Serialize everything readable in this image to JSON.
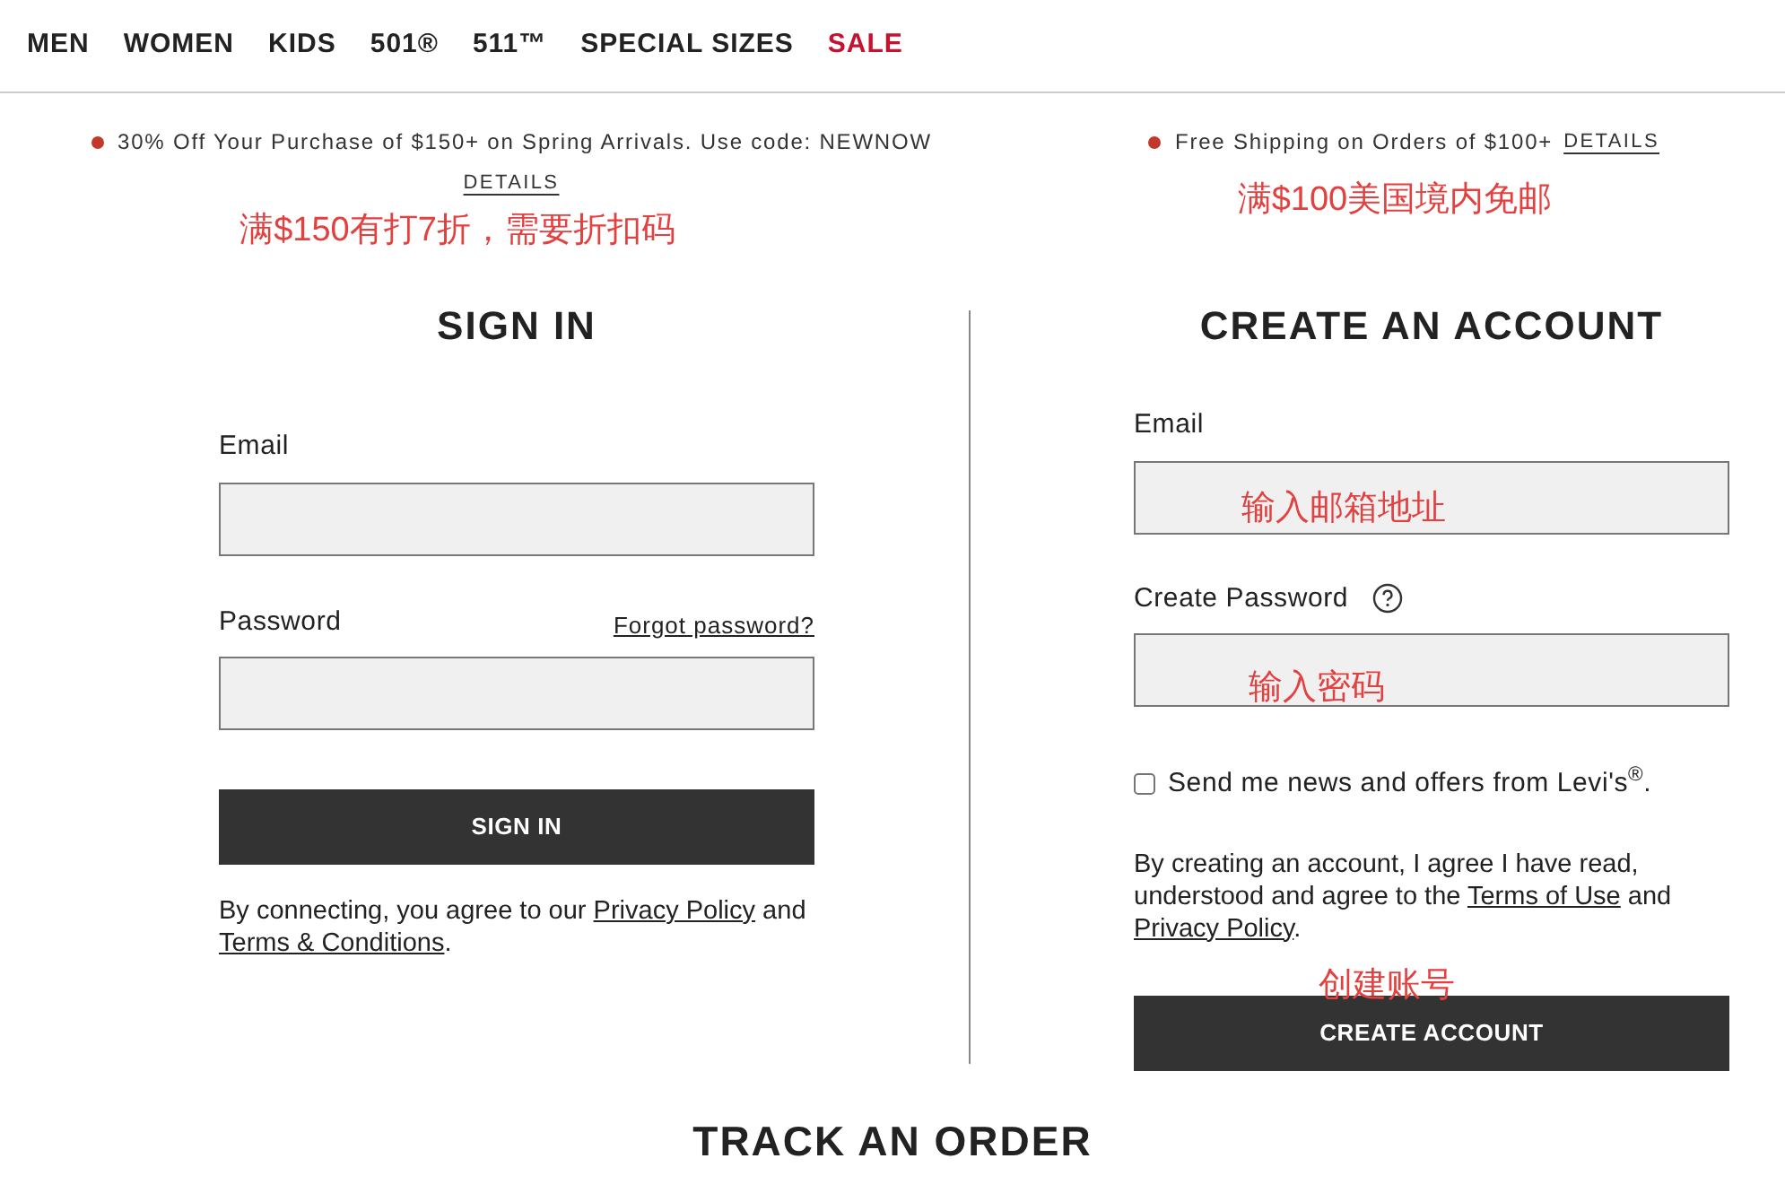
{
  "nav": [
    {
      "label": "MEN",
      "kind": "normal"
    },
    {
      "label": "WOMEN",
      "kind": "normal"
    },
    {
      "label": "KIDS",
      "kind": "normal"
    },
    {
      "label": "501®",
      "kind": "normal"
    },
    {
      "label": "511™",
      "kind": "normal"
    },
    {
      "label": "SPECIAL SIZES",
      "kind": "normal"
    },
    {
      "label": "SALE",
      "kind": "sale"
    }
  ],
  "promos": [
    {
      "text": "30% Off Your Purchase of $150+ on Spring Arrivals. Use code: NEWNOW",
      "link": "DETAILS",
      "annotation": "满$150有打7折，需要折扣码"
    },
    {
      "text": "Free Shipping on Orders of $100+",
      "link": "DETAILS",
      "annotation": "满$100美国境内免邮"
    }
  ],
  "sign_in": {
    "title": "SIGN IN",
    "email_label": "Email",
    "password_label": "Password",
    "forgot": "Forgot password?",
    "button": "SIGN IN",
    "legal": [
      {
        "text": "By connecting, you agree to our ",
        "link": false
      },
      {
        "text": "Privacy Policy",
        "link": true
      },
      {
        "text": " and ",
        "link": false
      },
      {
        "text": "Terms & Conditions",
        "link": true
      },
      {
        "text": ".",
        "link": false
      }
    ]
  },
  "create": {
    "title": "CREATE AN ACCOUNT",
    "email_label": "Email",
    "email_annotation": "输入邮箱地址",
    "password_label": "Create Password",
    "password_annotation": "输入密码",
    "newsletter": {
      "label": "Send me news and offers from Levi's$^{®}$.",
      "checked": false
    },
    "legal": [
      {
        "text": "By creating an account, I agree I have read, understood and agree to the ",
        "link": false
      },
      {
        "text": "Terms of Use",
        "link": true
      },
      {
        "text": " and ",
        "link": false
      },
      {
        "text": "Privacy Policy",
        "link": true
      },
      {
        "text": ".",
        "link": false
      }
    ],
    "button_annotation": "创建账号",
    "button": "CREATE ACCOUNT"
  },
  "track_order": {
    "title": "TRACK AN ORDER"
  }
}
